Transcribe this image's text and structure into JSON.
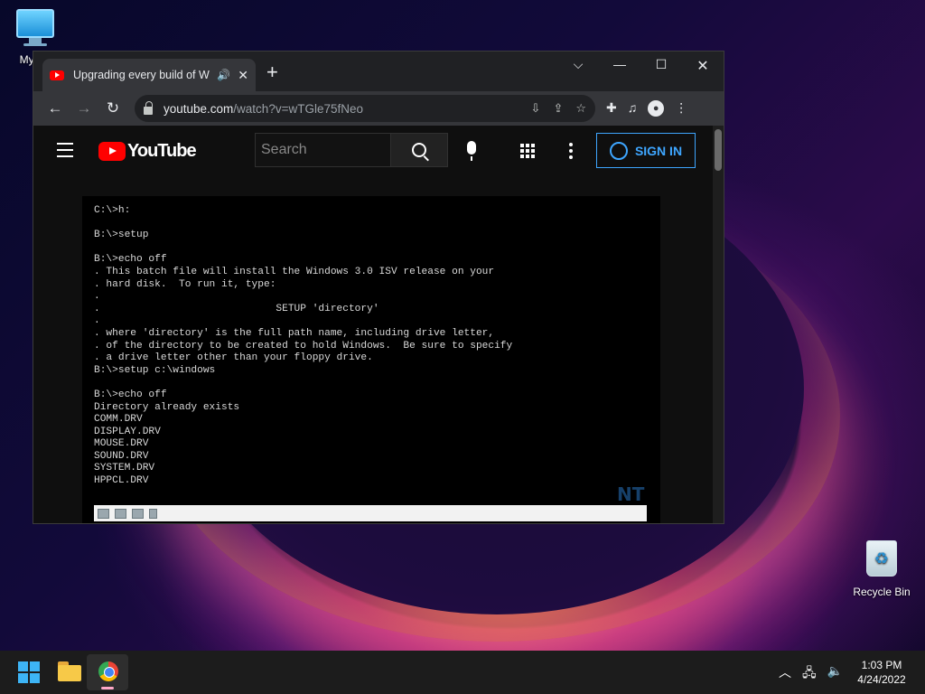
{
  "desktop": {
    "pc_icon_label": "My Co",
    "recycle_bin_label": "Recycle Bin"
  },
  "browser": {
    "tab_title": "Upgrading every build of Wi",
    "tab_audio_icon": "speaker-icon",
    "tab_close": "✕",
    "new_tab": "+",
    "window_controls": {
      "list": "⌵",
      "minimize": "—",
      "maximize": "☐",
      "close": "✕"
    },
    "nav": {
      "back": "←",
      "forward": "→",
      "reload": "↻"
    },
    "url_host": "youtube.com",
    "url_path": "/watch?v=wTGle75fNeo",
    "omni_icons": [
      "install-icon",
      "share-icon",
      "star-icon"
    ],
    "toolbar_icons": [
      "extensions-icon",
      "media-icon",
      "profile-icon",
      "menu-icon"
    ]
  },
  "youtube": {
    "logo_text": "YouTube",
    "search_placeholder": "Search",
    "sign_in_label": "SIGN IN"
  },
  "video": {
    "dos_lines": [
      "C:\\>h:",
      "",
      "B:\\>setup",
      "",
      "B:\\>echo off",
      ". This batch file will install the Windows 3.0 ISV release on your",
      ". hard disk.  To run it, type:",
      ".",
      ".                             SETUP 'directory'",
      ".",
      ". where 'directory' is the full path name, including drive letter,",
      ". of the directory to be created to hold Windows.  Be sure to specify",
      ". a drive letter other than your floppy drive.",
      "B:\\>setup c:\\windows",
      "",
      "B:\\>echo off",
      "Directory already exists",
      "COMM.DRV",
      "DISPLAY.DRV",
      "MOUSE.DRV",
      "SOUND.DRV",
      "SYSTEM.DRV",
      "HPPCL.DRV",
      "",
      "_"
    ],
    "watermark": "NT"
  },
  "taskbar": {
    "clock_time": "1:03 PM",
    "clock_date": "4/24/2022",
    "tray_icons": [
      "chevron-up-icon",
      "network-icon",
      "volume-icon"
    ]
  },
  "colors": {
    "yt_red": "#ff0000",
    "yt_blue": "#3ea6ff",
    "chrome_toolbar": "#35363a",
    "taskbar": "#1c1c1c"
  }
}
